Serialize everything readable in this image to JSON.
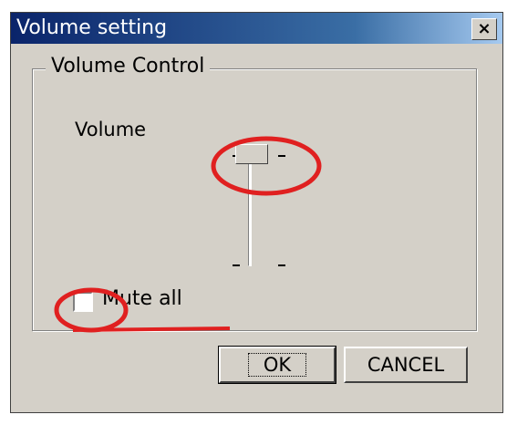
{
  "window": {
    "title": "Volume setting",
    "close_glyph": "×"
  },
  "group": {
    "label": "Volume Control"
  },
  "volume": {
    "label": "Volume",
    "level": 1.0
  },
  "mute": {
    "label": "Mute all",
    "checked": false
  },
  "buttons": {
    "ok": "OK",
    "cancel": "CANCEL"
  },
  "colors": {
    "annotation": "#e02020",
    "titlebar": "#0a246a"
  }
}
